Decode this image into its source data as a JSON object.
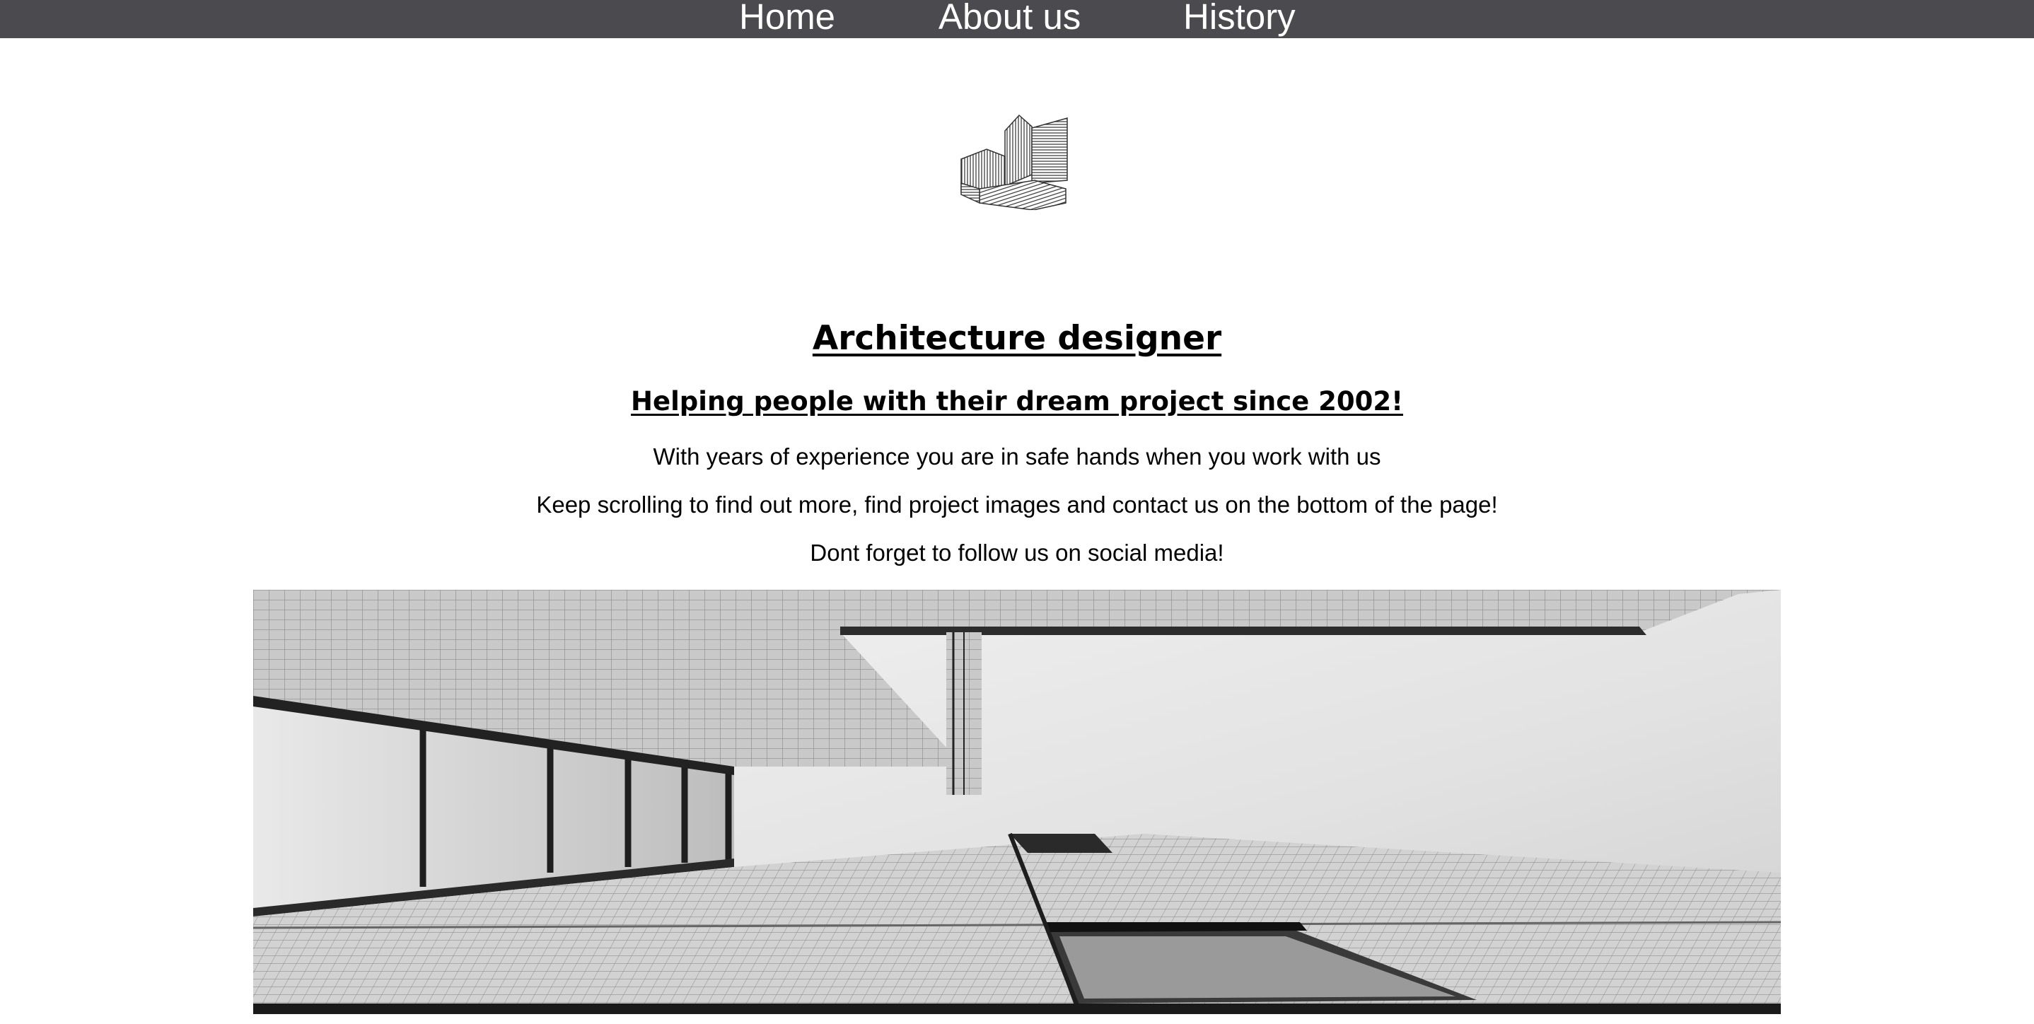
{
  "nav": {
    "items": [
      {
        "label": "Home"
      },
      {
        "label": "About us"
      },
      {
        "label": "History"
      }
    ],
    "background": "#4b4a4f",
    "text_color": "#ffffff"
  },
  "logo": {
    "icon": "striped-building-logo-icon"
  },
  "main": {
    "title": "Architecture designer",
    "subtitle": "Helping people with their dream project since 2002!",
    "paragraphs": [
      "With years of experience you are in safe hands when you work with us",
      "Keep scrolling to find out more, find project images and contact us on the bottom of the page!",
      "Dont forget to follow us on social media!"
    ]
  },
  "hero_image": {
    "icon": "building-photo-icon"
  }
}
